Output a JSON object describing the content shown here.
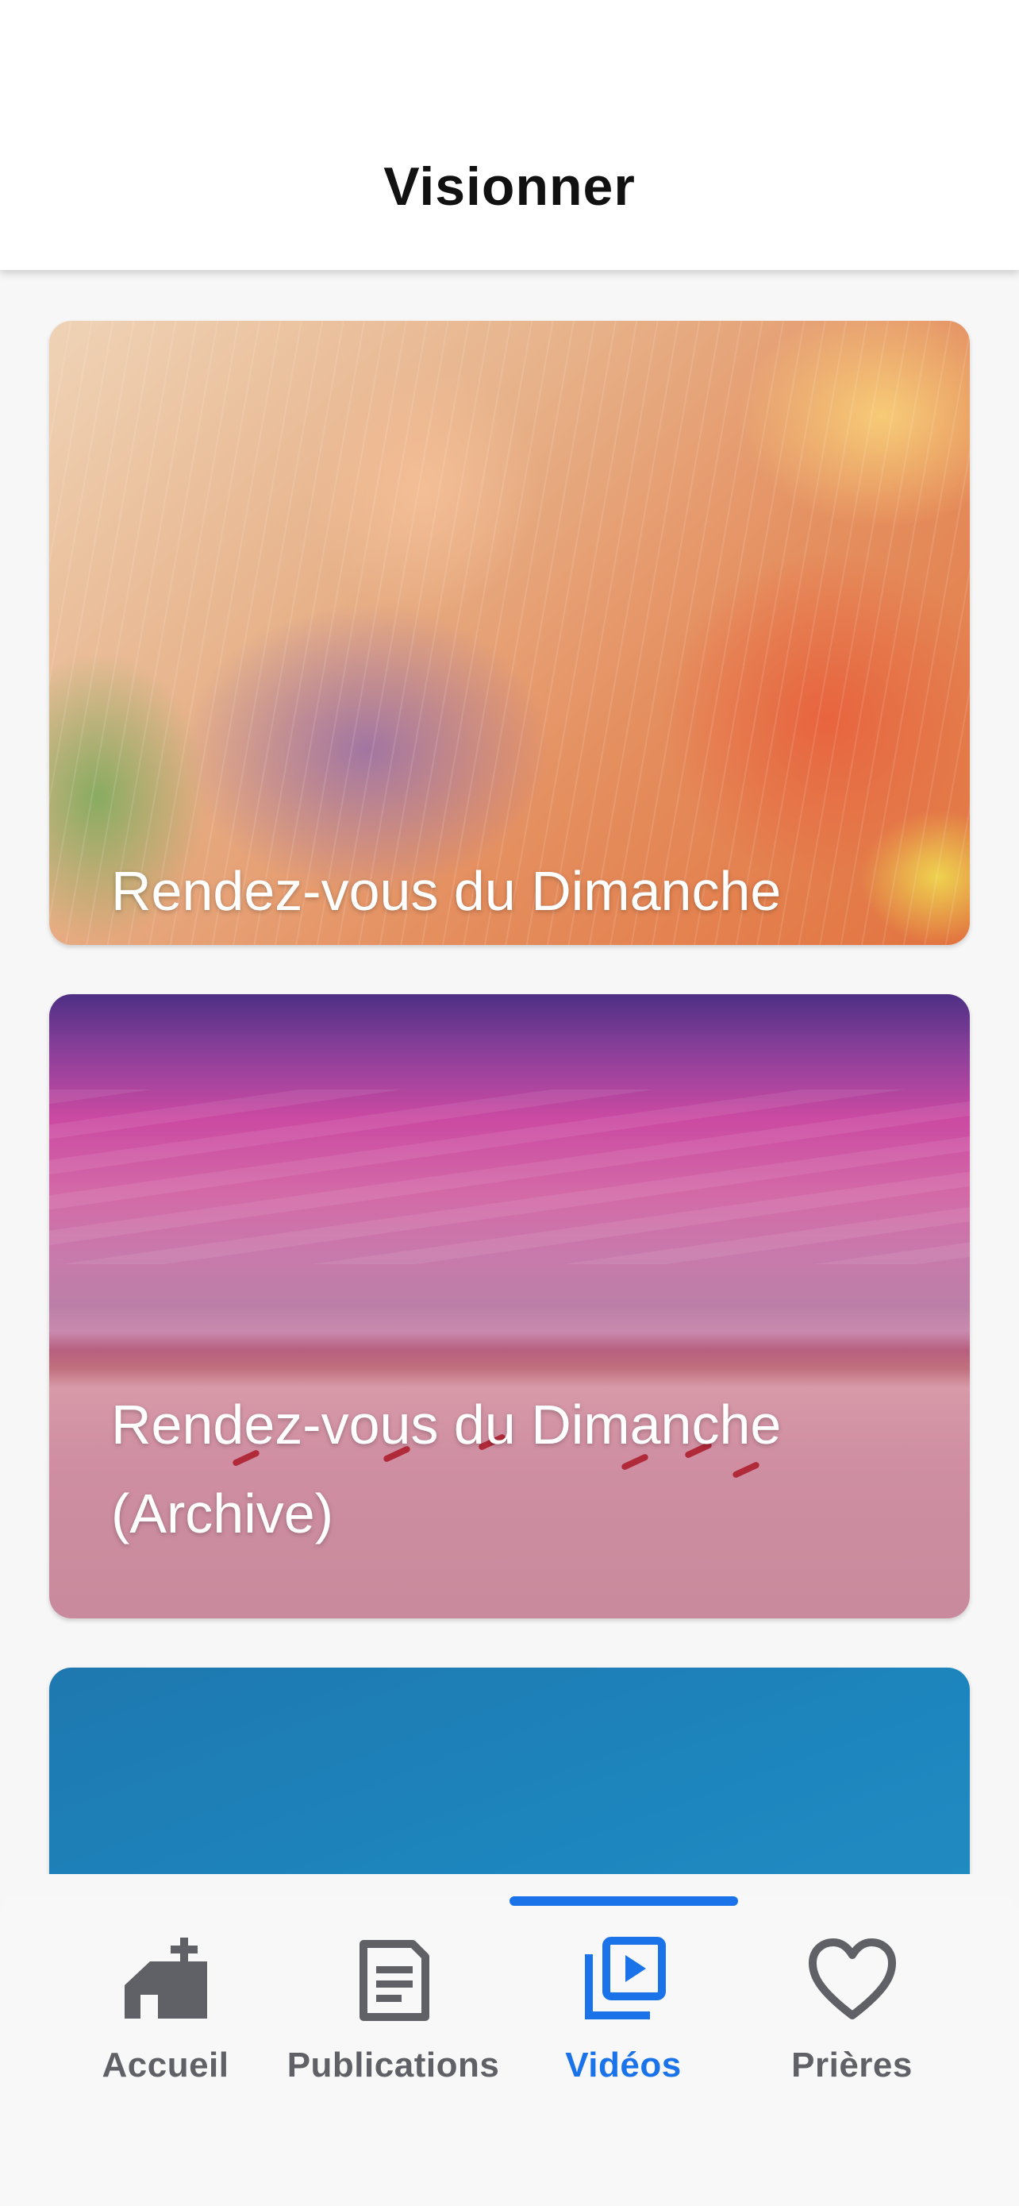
{
  "header": {
    "title": "Visionner"
  },
  "cards": [
    {
      "title": "Rendez-vous du Dimanche"
    },
    {
      "title": "Rendez-vous du Dimanche (Archive)"
    },
    {
      "title": ""
    }
  ],
  "nav": {
    "active": "Vidéos",
    "active_color": "#1a73e8",
    "inactive_color": "#5f6166",
    "items": [
      {
        "label": "Accueil",
        "icon": "church-icon"
      },
      {
        "label": "Publications",
        "icon": "article-icon"
      },
      {
        "label": "Vidéos",
        "icon": "video-library-icon"
      },
      {
        "label": "Prières",
        "icon": "heart-icon"
      }
    ]
  }
}
